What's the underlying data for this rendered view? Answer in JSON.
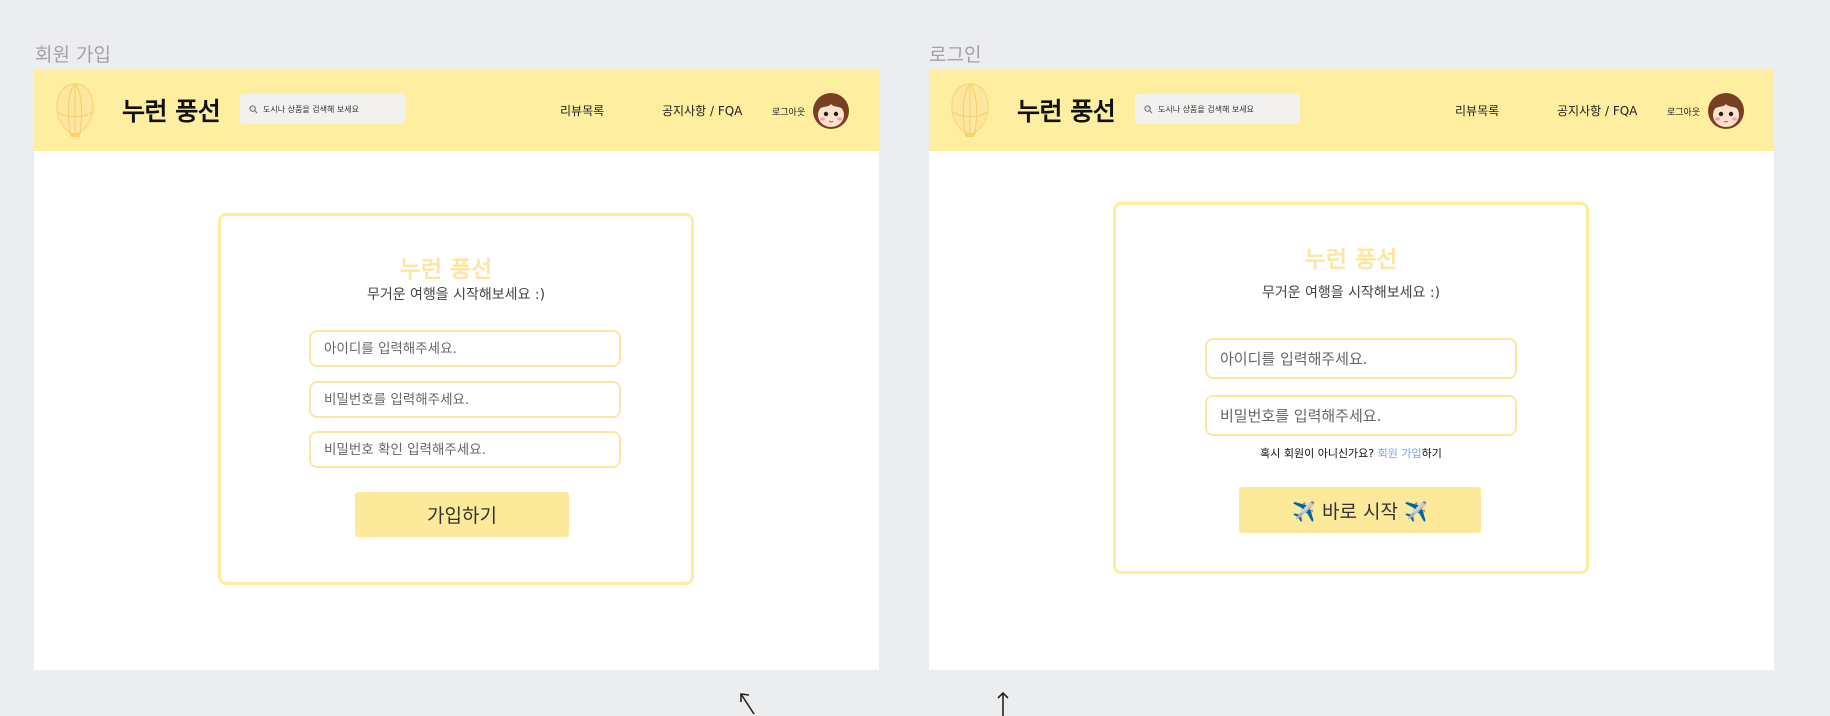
{
  "frames": {
    "signup": {
      "title": "회원 가입",
      "header": {
        "brand": "누런 풍선",
        "search_placeholder": "도시나 상품을 검색해 보세요",
        "nav_review": "리뷰목록",
        "nav_notice": "공지사항 / FQA",
        "logout": "로그아웃"
      },
      "card": {
        "title": "누런 풍선",
        "subtitle": "무거운 여행을 시작해보세요 :)",
        "id_placeholder": "아이디를 입력해주세요.",
        "pw_placeholder": "비밀번호를 입력해주세요.",
        "pw_confirm_placeholder": "비밀번호 확인 입력해주세요.",
        "submit_label": "가입하기"
      }
    },
    "login": {
      "title": "로그인",
      "header": {
        "brand": "누런 풍선",
        "search_placeholder": "도시나 상품을 검색해 보세요",
        "nav_review": "리뷰목록",
        "nav_notice": "공지사항 / FQA",
        "logout": "로그아웃"
      },
      "card": {
        "title": "누런 풍선",
        "subtitle": "무거운 여행을 시작해보세요 :)",
        "id_placeholder": "아이디를 입력해주세요.",
        "pw_placeholder": "비밀번호를 입력해주세요.",
        "hint_prefix": "혹시 회원이 아니신가요? ",
        "hint_link": "회원 가입",
        "hint_suffix": "하기",
        "submit_label": "✈️ 바로 시작 ✈️"
      }
    }
  },
  "icons": {
    "logo": "balloon-icon",
    "search": "search-icon",
    "avatar": "avatar-icon"
  },
  "colors": {
    "header_bg": "#fdeea0",
    "card_border": "#fdeda0",
    "title_color": "#fde6a3",
    "button_bg": "#fde99a",
    "link_color": "#7ba3e6",
    "canvas_bg": "#ecedef"
  }
}
